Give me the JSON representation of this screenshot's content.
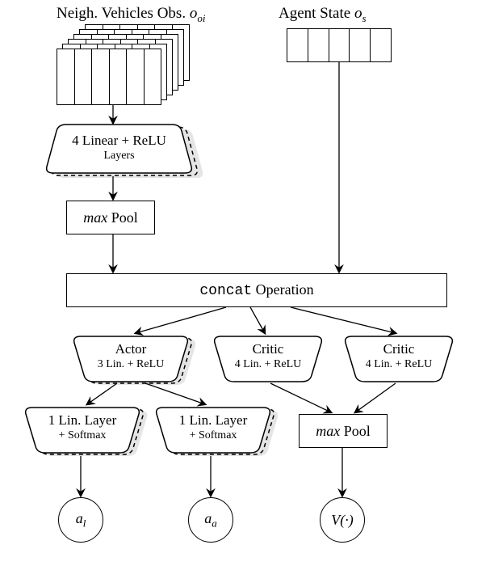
{
  "labels": {
    "neigh": "Neigh. Vehicles Obs.",
    "neigh_sym": "o",
    "neigh_sub": "oi",
    "agent": "Agent State",
    "agent_sym": "o",
    "agent_sub": "s"
  },
  "blocks": {
    "encoder": {
      "l1": "4 Linear + ReLU",
      "l2": "Layers"
    },
    "maxpool1": "max",
    "maxpool1_suffix": " Pool",
    "concat_mono": "concat",
    "concat_suffix": " Operation",
    "actor": {
      "title": "Actor",
      "sub": "3 Lin. + ReLU"
    },
    "critic": {
      "title": "Critic",
      "sub": "4 Lin. + ReLU"
    },
    "softmax": "1 Lin. Layer",
    "softmax2": "+ Softmax",
    "maxpool2": "max",
    "maxpool2_suffix": " Pool"
  },
  "outputs": {
    "al": "a",
    "al_sub": "l",
    "aa": "a",
    "aa_sub": "a",
    "v": "V(·)"
  }
}
